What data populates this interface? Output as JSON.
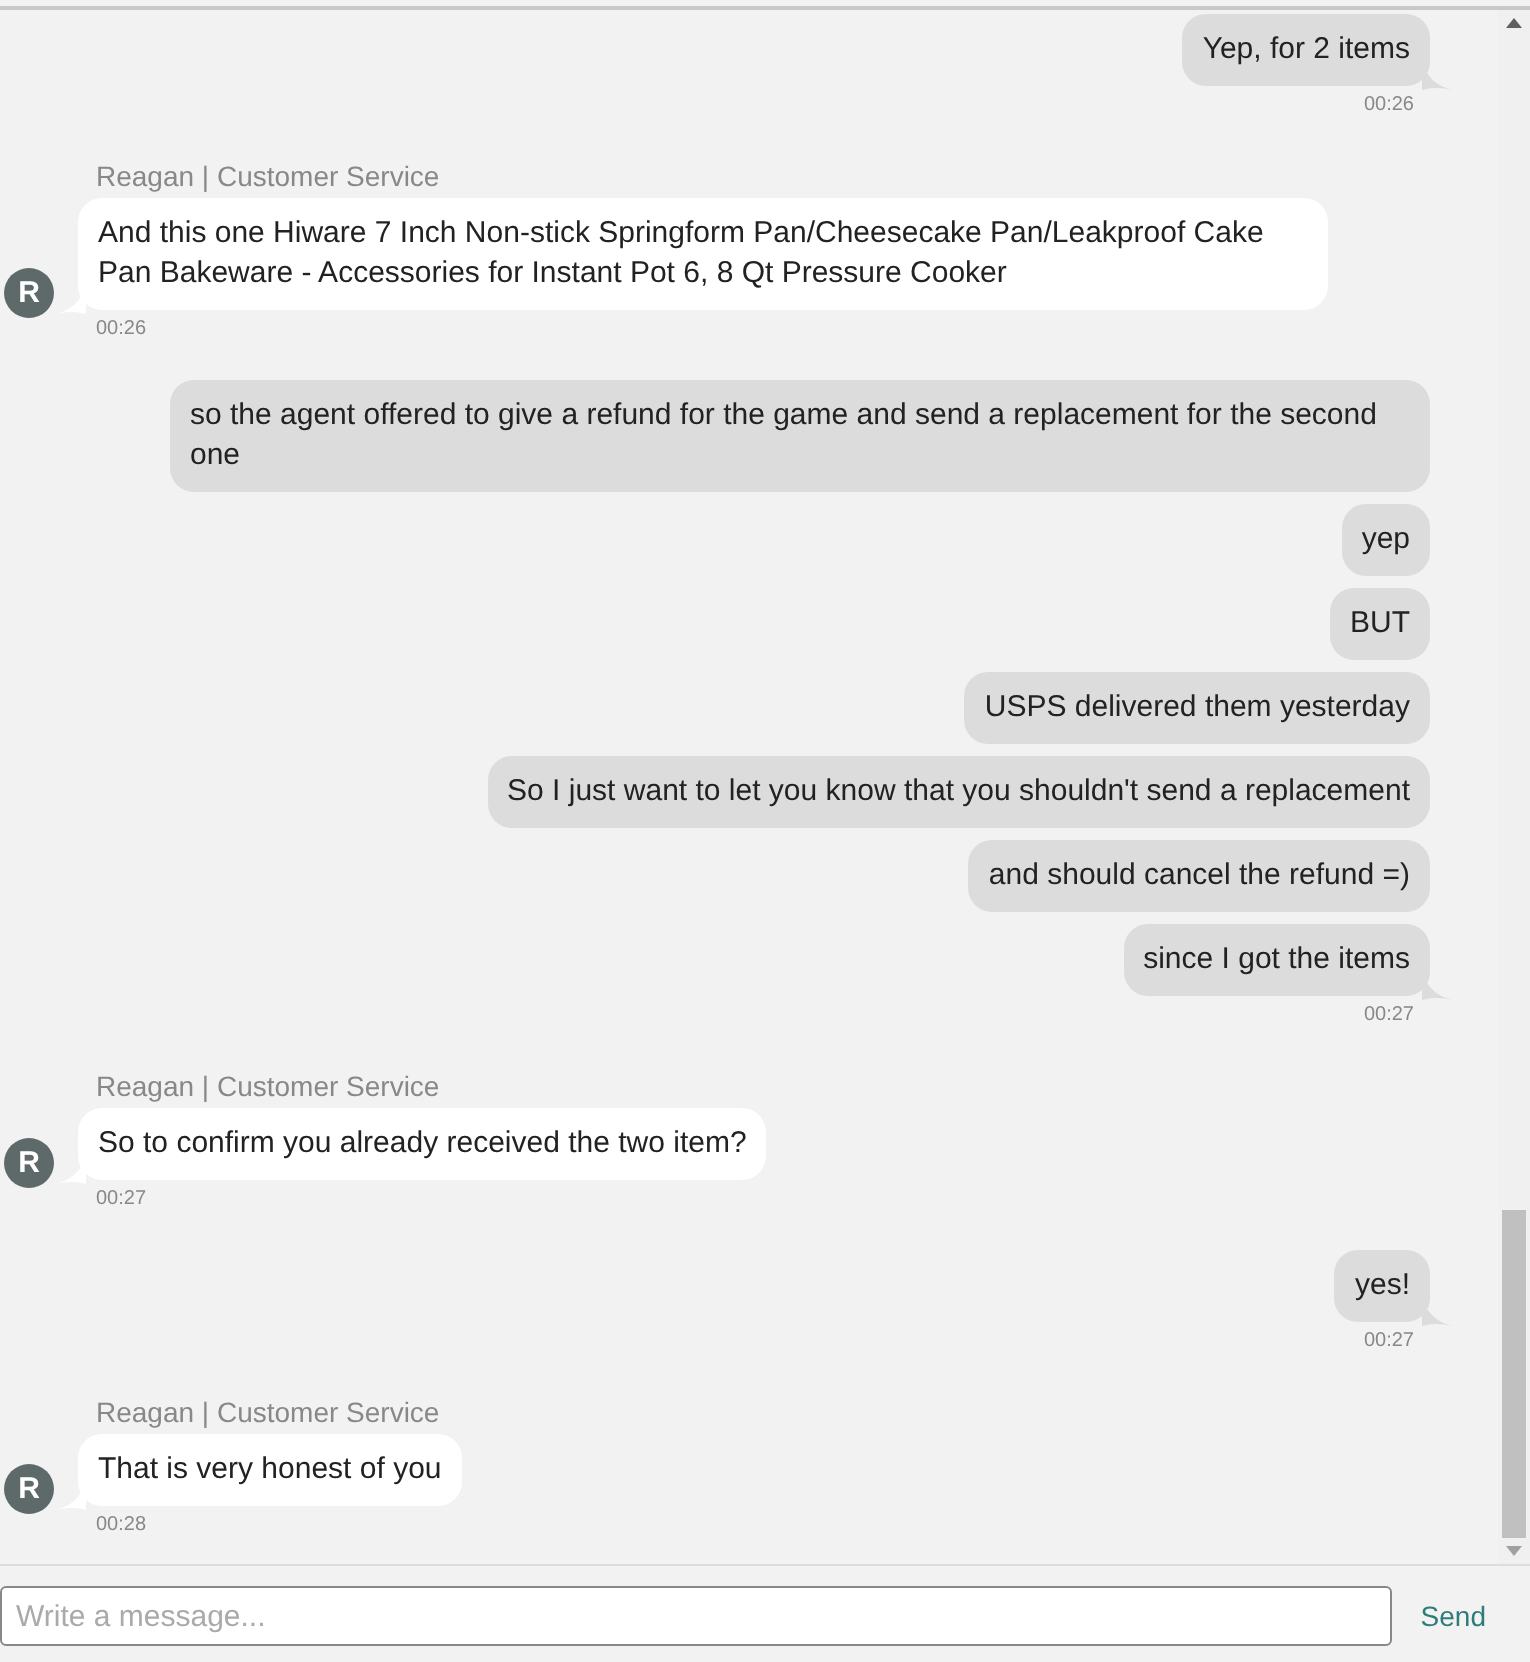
{
  "conversation": [
    {
      "kind": "customer",
      "messages": [
        "Yep, for 2 items"
      ],
      "time": "00:26"
    },
    {
      "kind": "agent",
      "sender": "Reagan | Customer Service",
      "avatar": "R",
      "messages": [
        "And this one Hiware 7 Inch Non-stick Springform Pan/Cheesecake Pan/Leakproof Cake Pan Bakeware - Accessories for Instant Pot 6, 8 Qt Pressure Cooker"
      ],
      "time": "00:26"
    },
    {
      "kind": "customer",
      "messages": [
        "so the agent offered to give a refund for the game and send a replacement for the second one",
        "yep",
        "BUT",
        "USPS delivered them yesterday",
        "So I just want to let you know that you shouldn't send a replacement",
        "and should cancel the refund =)",
        "since I got the items"
      ],
      "time": "00:27"
    },
    {
      "kind": "agent",
      "sender": "Reagan | Customer Service",
      "avatar": "R",
      "messages": [
        "So to confirm you already received the two item?"
      ],
      "time": "00:27"
    },
    {
      "kind": "customer",
      "messages": [
        "yes!"
      ],
      "time": "00:27"
    },
    {
      "kind": "agent",
      "sender": "Reagan | Customer Service",
      "avatar": "R",
      "messages": [
        "That is very honest of you"
      ],
      "time": "00:28"
    }
  ],
  "composer": {
    "placeholder": "Write a message...",
    "send": "Send"
  }
}
